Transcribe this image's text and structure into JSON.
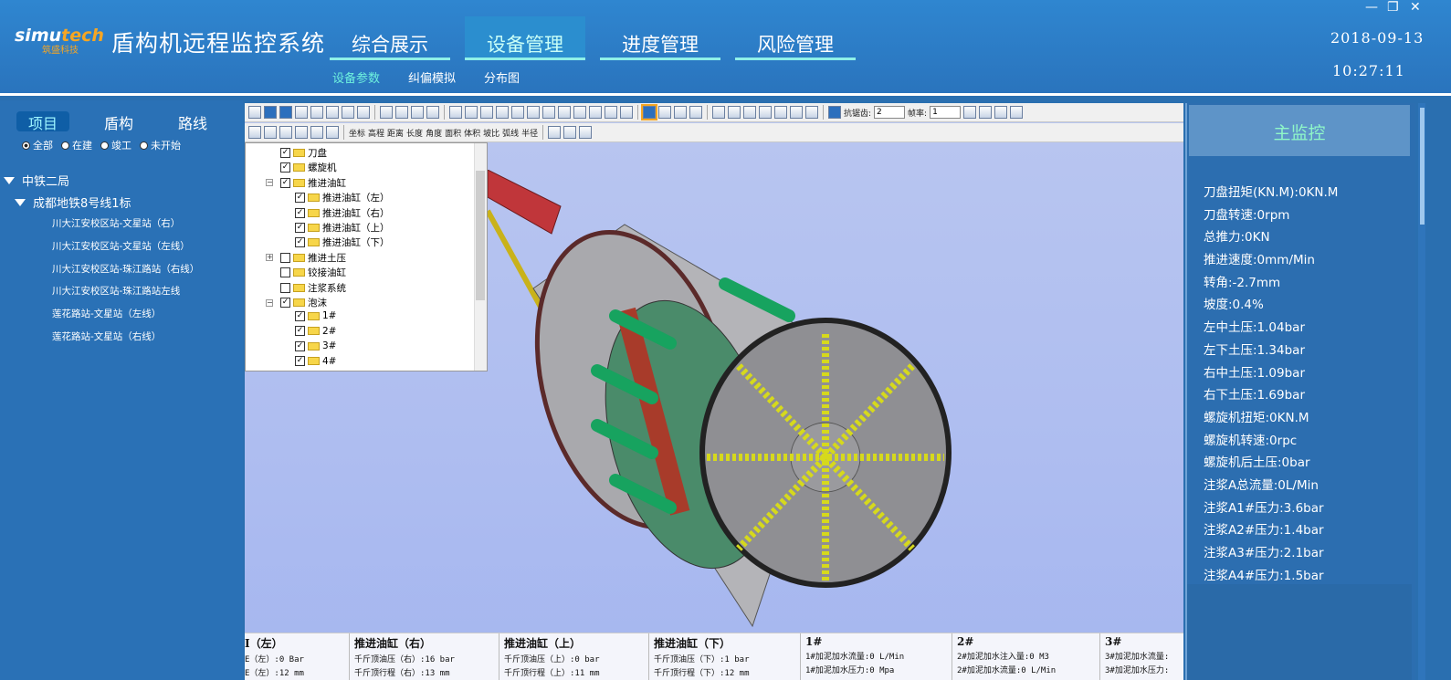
{
  "header": {
    "logo_main": "simu",
    "logo_accent": "tech",
    "logo_sub": "筑盛科技",
    "title": "盾构机远程监控系统",
    "nav": [
      {
        "label": "综合展示"
      },
      {
        "label": "设备管理"
      },
      {
        "label": "进度管理"
      },
      {
        "label": "风险管理"
      }
    ],
    "subnav": [
      {
        "label": "设备参数"
      },
      {
        "label": "纠偏模拟"
      },
      {
        "label": "分布图"
      }
    ],
    "date": "2018-09-13",
    "time": "10:27:11",
    "window_controls": {
      "minimize": "—",
      "maximize": "❐",
      "close": "✕"
    }
  },
  "left": {
    "tabs": [
      {
        "label": "项目"
      },
      {
        "label": "盾构"
      },
      {
        "label": "路线"
      }
    ],
    "filters": [
      {
        "label": "全部",
        "selected": true
      },
      {
        "label": "在建",
        "selected": false
      },
      {
        "label": "竣工",
        "selected": false
      },
      {
        "label": "未开始",
        "selected": false
      }
    ],
    "tree": {
      "company": "中铁二局",
      "project": "成都地铁8号线1标",
      "routes": [
        "川大江安校区站-文星站（右）",
        "川大江安校区站-文星站（左线）",
        "川大江安校区站-珠江路站（右线）",
        "川大江安校区站-珠江路站左线",
        "莲花路站-文星站（左线）",
        "莲花路站-文星站（右线）"
      ]
    }
  },
  "toolbar": {
    "aa_label": "抗锯齿:",
    "aa_value": "2",
    "frame_label": "帧率:",
    "frame_value": "1",
    "tools": [
      "坐标",
      "高程",
      "距离",
      "长度",
      "角度",
      "面积",
      "体积",
      "坡比",
      "弧线",
      "半径"
    ]
  },
  "layers": [
    {
      "label": "刀盘",
      "checked": true,
      "level": 1,
      "expander": ""
    },
    {
      "label": "螺旋机",
      "checked": true,
      "level": 1,
      "expander": ""
    },
    {
      "label": "推进油缸",
      "checked": true,
      "level": 1,
      "expander": "−"
    },
    {
      "label": "推进油缸（左）",
      "checked": true,
      "level": 2,
      "expander": ""
    },
    {
      "label": "推进油缸（右）",
      "checked": true,
      "level": 2,
      "expander": ""
    },
    {
      "label": "推进油缸（上）",
      "checked": true,
      "level": 2,
      "expander": ""
    },
    {
      "label": "推进油缸（下）",
      "checked": true,
      "level": 2,
      "expander": ""
    },
    {
      "label": "推进土压",
      "checked": false,
      "level": 1,
      "expander": "+"
    },
    {
      "label": "铰接油缸",
      "checked": false,
      "level": 1,
      "expander": ""
    },
    {
      "label": "注浆系统",
      "checked": false,
      "level": 1,
      "expander": ""
    },
    {
      "label": "泡沫",
      "checked": true,
      "level": 1,
      "expander": "−"
    },
    {
      "label": "1#",
      "checked": true,
      "level": 2,
      "expander": ""
    },
    {
      "label": "2#",
      "checked": true,
      "level": 2,
      "expander": ""
    },
    {
      "label": "3#",
      "checked": true,
      "level": 2,
      "expander": ""
    },
    {
      "label": "4#",
      "checked": true,
      "level": 2,
      "expander": ""
    }
  ],
  "info": [
    {
      "title": "I（左）",
      "rows": [
        "E（左）:0 Bar",
        "E（左）:12 mm"
      ]
    },
    {
      "title": "推进油缸（右）",
      "rows": [
        "千斤顶油压（右）:16 bar",
        "千斤顶行程（右）:13 mm"
      ]
    },
    {
      "title": "推进油缸（上）",
      "rows": [
        "千斤顶油压（上）:0 bar",
        "千斤顶行程（上）:11 mm"
      ]
    },
    {
      "title": "推进油缸（下）",
      "rows": [
        "千斤顶油压（下）:1 bar",
        "千斤顶行程（下）:12 mm"
      ]
    },
    {
      "title": "1#",
      "rows": [
        "1#加泥加水流量:0 L/Min",
        "1#加泥加水压力:0 Mpa"
      ]
    },
    {
      "title": "2#",
      "rows": [
        "2#加泥加水注入量:0 M3",
        "2#加泥加水流量:0 L/Min"
      ]
    },
    {
      "title": "3#",
      "rows": [
        "3#加泥加水流量:",
        "3#加泥加水压力:"
      ]
    }
  ],
  "monitor": {
    "title": "主监控",
    "metrics": [
      "刀盘扭矩(KN.M):0KN.M",
      "刀盘转速:0rpm",
      "总推力:0KN",
      "推进速度:0mm/Min",
      "转角:-2.7mm",
      "坡度:0.4%",
      "左中土压:1.04bar",
      "左下土压:1.34bar",
      "右中土压:1.09bar",
      "右下土压:1.69bar",
      "螺旋机扭矩:0KN.M",
      "螺旋机转速:0rpc",
      "螺旋机后土压:0bar",
      "注浆A总流量:0L/Min",
      "注浆A1#压力:3.6bar",
      "注浆A2#压力:1.4bar",
      "注浆A3#压力:2.1bar",
      "注浆A4#压力:1.5bar"
    ]
  },
  "colors": {
    "header_bg": "#2a74bd",
    "accent": "#6ef1de",
    "viewport_bg": "#aebdf0",
    "monitor_title": "#8ff7c8"
  }
}
